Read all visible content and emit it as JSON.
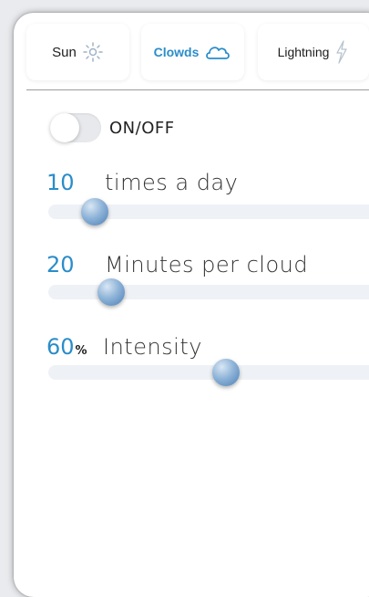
{
  "tabs": [
    {
      "label": "Sun",
      "icon": "sun-icon",
      "active": false
    },
    {
      "label": "Clowds",
      "icon": "cloud-icon",
      "active": true
    },
    {
      "label": "Lightning",
      "icon": "lightning-icon",
      "active": false
    }
  ],
  "toggle": {
    "label": "ON/OFF",
    "state": "off"
  },
  "settings": [
    {
      "value": "10",
      "unit": "",
      "label": "times a day",
      "level": 0.12
    },
    {
      "value": "20",
      "unit": "",
      "label": "Minutes per cloud",
      "level": 0.18
    },
    {
      "value": "60",
      "unit": "%",
      "label": "Intensity",
      "level": 0.6
    }
  ],
  "colors": {
    "accent": "#2a8dc9",
    "text": "#222222",
    "track": "#eef1f5",
    "background": "#ffffff"
  }
}
